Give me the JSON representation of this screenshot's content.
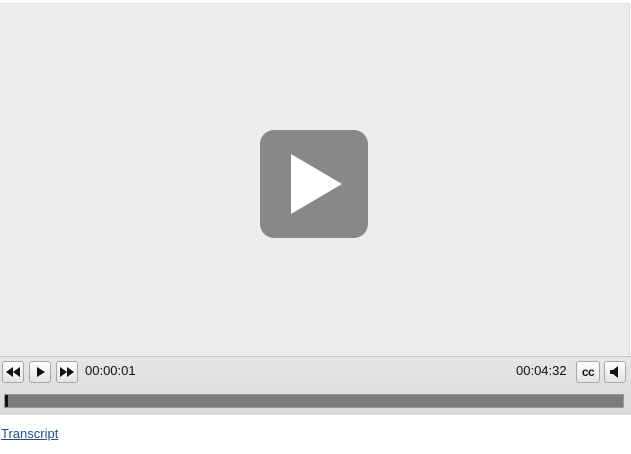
{
  "player": {
    "big_play_icon": "play-icon",
    "controls": {
      "rewind_icon": "rewind-icon",
      "play_icon": "play-icon",
      "fast_forward_icon": "fast-forward-icon",
      "current_time": "00:00:01",
      "duration": "00:04:32",
      "cc_label": "cc",
      "volume_icon": "speaker-icon"
    },
    "progress_fraction": 0.0037
  },
  "transcript_link": "Transcript",
  "colors": {
    "video_background": "#ededeb",
    "big_play_button": "#888887",
    "seek_track": "#7b7b7b",
    "seek_played": "#111111",
    "link": "#1f4e9a"
  }
}
